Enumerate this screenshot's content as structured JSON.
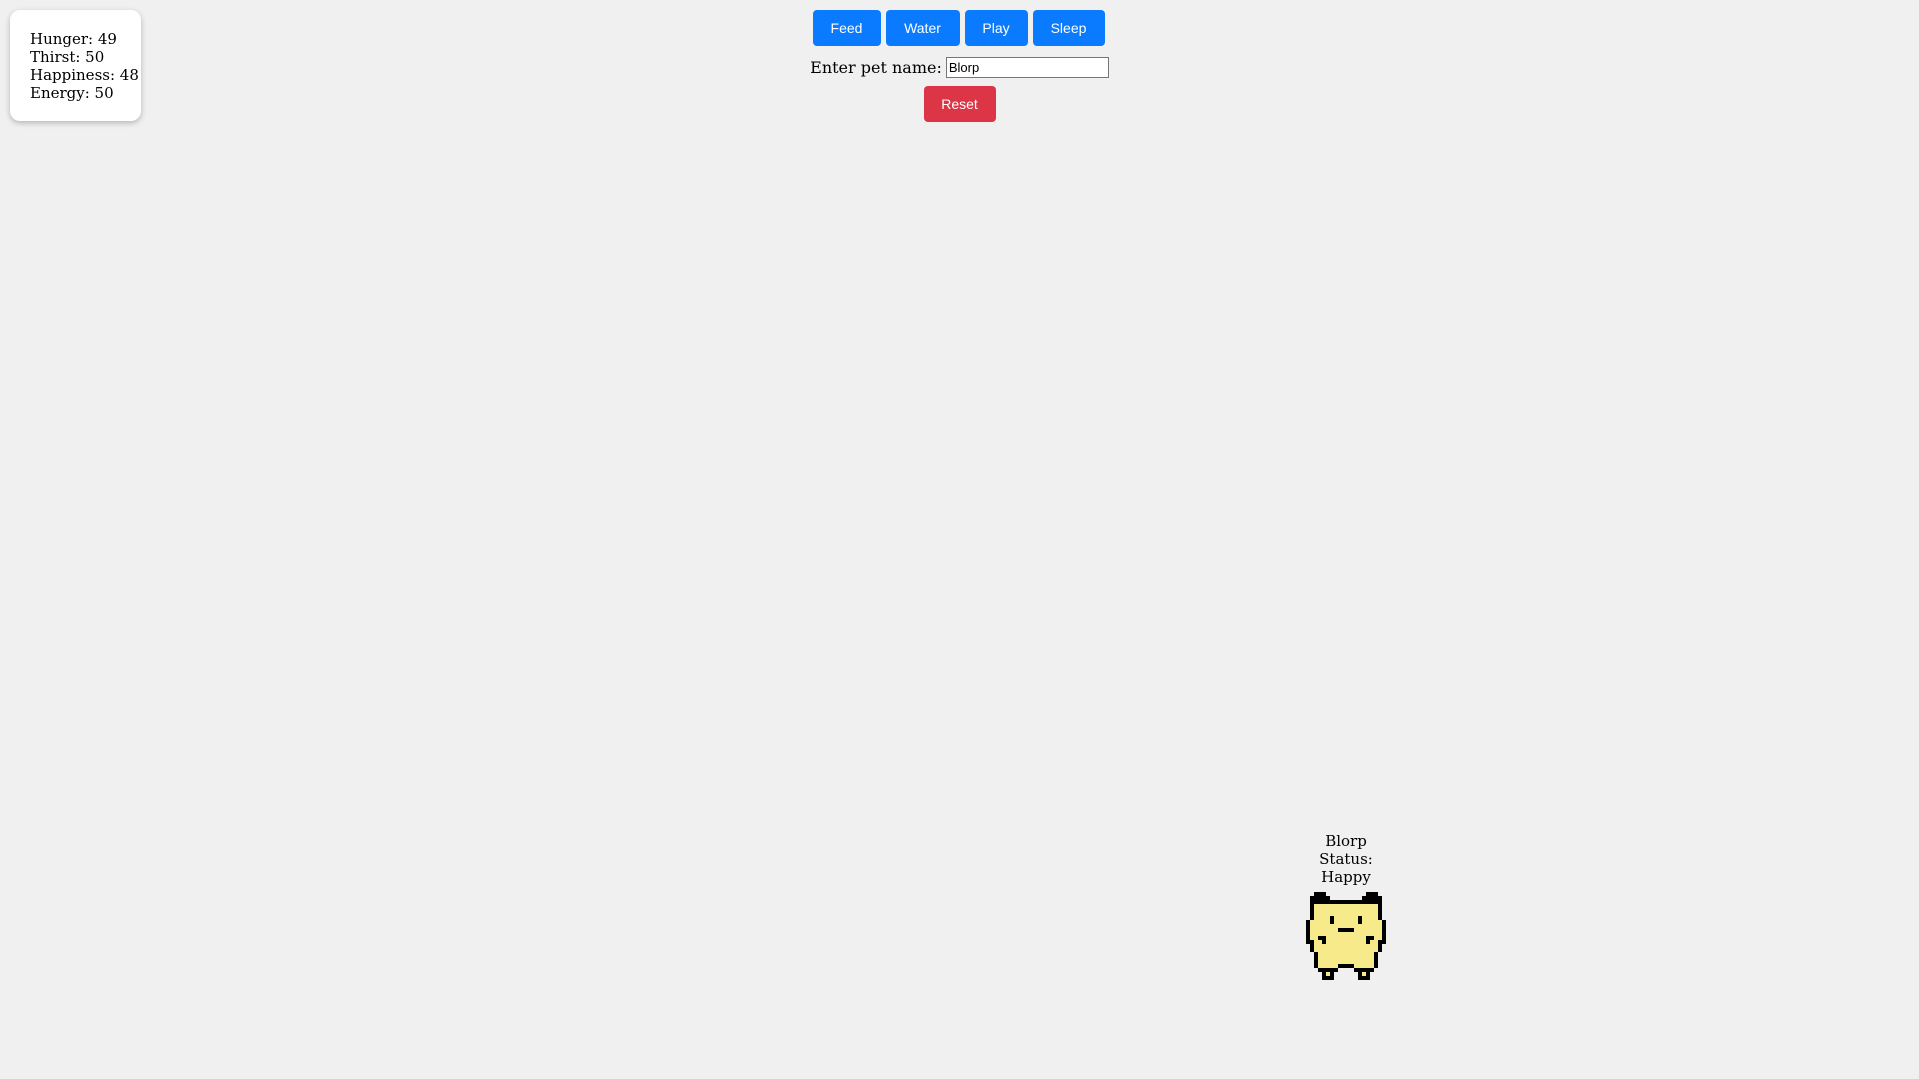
{
  "stats": {
    "hunger": "Hunger: 49",
    "thirst": "Thirst: 50",
    "happiness": "Happiness: 48",
    "energy": "Energy: 50"
  },
  "actions": {
    "feed_label": "Feed",
    "water_label": "Water",
    "play_label": "Play",
    "sleep_label": "Sleep"
  },
  "name_form": {
    "label": "Enter pet name:",
    "value": "Blorp"
  },
  "reset_label": "Reset",
  "pet": {
    "name": "Blorp",
    "status": "Status: Happy",
    "sprite_icon": "pet-sprite-icon",
    "body_color": "#f7ea8a"
  },
  "colors": {
    "background": "#f0f0f0",
    "action_button": "#0a7bff",
    "reset_button": "#dc3545"
  }
}
